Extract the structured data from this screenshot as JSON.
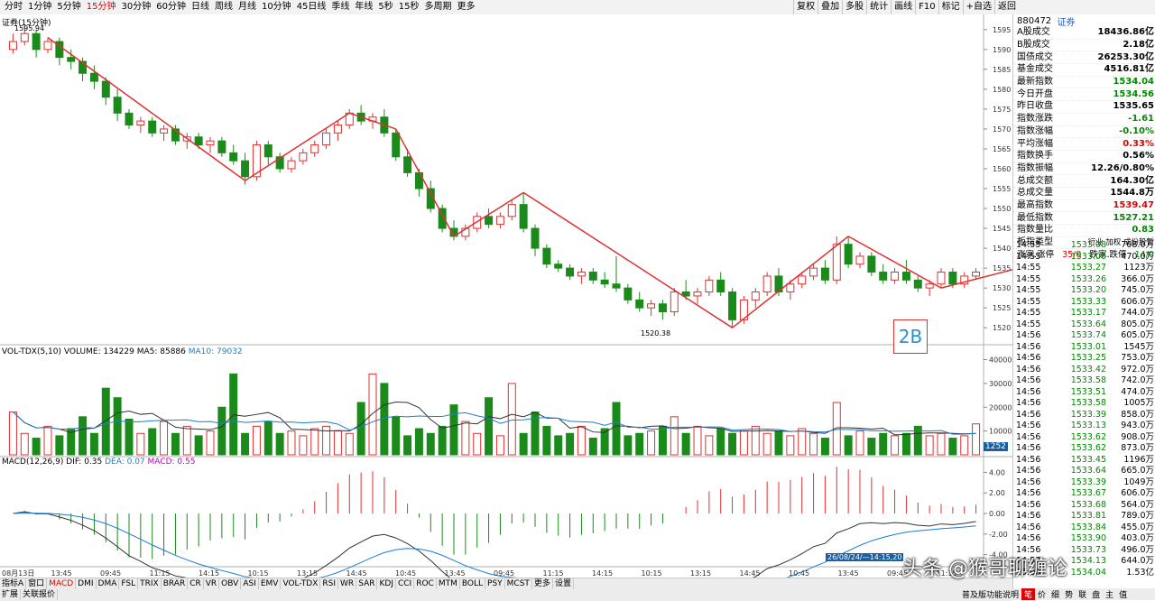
{
  "period_tabs": [
    "分时",
    "1分钟",
    "5分钟",
    "15分钟",
    "30分钟",
    "60分钟",
    "日线",
    "周线",
    "月线",
    "10分钟",
    "45日线",
    "季线",
    "年线",
    "5秒",
    "15秒",
    "多周期",
    "更多"
  ],
  "active_period": "15分钟",
  "right_buttons": [
    "复权",
    "叠加",
    "多股",
    "统计",
    "画线",
    "F10",
    "标记",
    "+自选",
    "返回"
  ],
  "chart": {
    "title": "证券(15分钟)",
    "high_label": "1595.94",
    "low_label": "1520.38",
    "y_ticks": [
      1595,
      1590,
      1585,
      1580,
      1575,
      1570,
      1565,
      1560,
      1555,
      1550,
      1545,
      1540,
      1535,
      1530,
      1525,
      1520
    ],
    "annotation": "2B"
  },
  "volume": {
    "label": "VOL-TDX(5,10)",
    "volume_text": "VOLUME: 134229",
    "ma5_text": "MA5: 85886",
    "ma10_text": "MA10: 79032",
    "y_ticks": [
      "40000",
      "30000",
      "20000",
      "10000"
    ],
    "current": "1252"
  },
  "macd": {
    "label": "MACD(12,26,9)",
    "dif_text": "DIF: 0.35",
    "dea_text": "DEA: 0.07",
    "macd_text": "MACD: 0.55",
    "y_ticks": [
      "4.00",
      "2.00",
      "0.00",
      "-2.00",
      "-4.00"
    ]
  },
  "time_axis": [
    "08月13日",
    "13:45",
    "09:45",
    "11:15",
    "14:15",
    "10:15",
    "13:15",
    "14:45",
    "10:45",
    "13:45",
    "09:45",
    "11:15",
    "14:15",
    "10:15",
    "13:15",
    "14:45",
    "10:45",
    "13:45",
    "09:45",
    "11:15"
  ],
  "cursor_time": "26/08/24/—14:15,20",
  "indicator_tabs": [
    "指标A",
    "窗口",
    "MACD",
    "DMI",
    "DMA",
    "FSL",
    "TRIX",
    "BRAR",
    "CR",
    "VR",
    "OBV",
    "ASI",
    "EMV",
    "VOL-TDX",
    "RSI",
    "WR",
    "SAR",
    "KDJ",
    "CCI",
    "ROC",
    "MTM",
    "BOLL",
    "PSY",
    "MCST",
    "更多",
    "设置"
  ],
  "active_indicator": "MACD",
  "bottom_tabs": [
    "扩展",
    "关联报价"
  ],
  "indicator_b": "指标B",
  "panel": {
    "code": "880472",
    "name": "证券",
    "stats": [
      {
        "k": "A股成交",
        "v": "18436.86亿",
        "c": "#000"
      },
      {
        "k": "B股成交",
        "v": "2.18亿",
        "c": "#000"
      },
      {
        "k": "国债成交",
        "v": "26253.30亿",
        "c": "#000"
      },
      {
        "k": "基金成交",
        "v": "4516.81亿",
        "c": "#000"
      },
      {
        "k": "最新指数",
        "v": "1534.04",
        "c": "#080"
      },
      {
        "k": "今日开盘",
        "v": "1534.56",
        "c": "#080"
      },
      {
        "k": "昨日收盘",
        "v": "1535.65",
        "c": "#000"
      },
      {
        "k": "指数涨跌",
        "v": "-1.61",
        "c": "#080"
      },
      {
        "k": "指数涨幅",
        "v": "-0.10%",
        "c": "#080"
      },
      {
        "k": "平均涨幅",
        "v": "0.33%",
        "c": "#e00000"
      },
      {
        "k": "指数换手",
        "v": "0.56%",
        "c": "#000"
      },
      {
        "k": "指数振幅",
        "v": "12.26/0.80%",
        "c": "#000"
      },
      {
        "k": "总成交额",
        "v": "164.30亿",
        "c": "#000"
      },
      {
        "k": "总成交量",
        "v": "1544.8万",
        "c": "#000"
      },
      {
        "k": "最高指数",
        "v": "1539.47",
        "c": "#e00000"
      },
      {
        "k": "最低指数",
        "v": "1527.21",
        "c": "#080"
      },
      {
        "k": "指数量比",
        "v": "0.83",
        "c": "#080"
      },
      {
        "k": "板指类型",
        "v": "行业 加权 成份股暂",
        "c": "#000"
      }
    ],
    "updown_label": "涨家.涨停",
    "updown_value": "35/0",
    "down_label": "跌家.跌停",
    "down_value": "14/0",
    "trades": [
      [
        "14:55",
        "1533.08",
        "708.0万"
      ],
      [
        "14:55",
        "1533.00",
        "470.0万"
      ],
      [
        "14:55",
        "1533.27",
        "1123万"
      ],
      [
        "14:55",
        "1533.26",
        "366.0万"
      ],
      [
        "14:55",
        "1533.20",
        "745.0万"
      ],
      [
        "14:55",
        "1533.33",
        "606.0万"
      ],
      [
        "14:55",
        "1533.17",
        "744.0万"
      ],
      [
        "14:55",
        "1533.64",
        "805.0万"
      ],
      [
        "14:56",
        "1533.74",
        "605.0万"
      ],
      [
        "14:56",
        "1533.01",
        "1545万"
      ],
      [
        "14:56",
        "1533.25",
        "753.0万"
      ],
      [
        "14:56",
        "1533.42",
        "972.0万"
      ],
      [
        "14:56",
        "1533.58",
        "742.0万"
      ],
      [
        "14:56",
        "1533.51",
        "474.0万"
      ],
      [
        "14:56",
        "1533.58",
        "1005万"
      ],
      [
        "14:56",
        "1533.39",
        "858.0万"
      ],
      [
        "14:56",
        "1533.13",
        "943.0万"
      ],
      [
        "14:56",
        "1533.62",
        "908.0万"
      ],
      [
        "14:56",
        "1533.62",
        "873.0万"
      ],
      [
        "14:56",
        "1533.45",
        "1196万"
      ],
      [
        "14:56",
        "1533.64",
        "665.0万"
      ],
      [
        "14:56",
        "1533.39",
        "1049万"
      ],
      [
        "14:56",
        "1533.67",
        "606.0万"
      ],
      [
        "14:56",
        "1533.68",
        "564.0万"
      ],
      [
        "14:56",
        "1533.81",
        "789.0万"
      ],
      [
        "14:56",
        "1533.84",
        "455.0万"
      ],
      [
        "14:56",
        "1533.90",
        "403.0万"
      ],
      [
        "14:56",
        "1533.73",
        "496.0万"
      ],
      [
        "14:57",
        "1534.13",
        "644.0万"
      ],
      [
        "15:00",
        "1534.04",
        "1.53亿"
      ]
    ],
    "bottom_status": "普及版功能说明",
    "bottom_icons": [
      "笔",
      "价",
      "细",
      "势",
      "联",
      "盘",
      "主",
      "值"
    ]
  },
  "watermark": "头条 @猴哥聊缠论",
  "series": [
    [
      1590,
      1594,
      1589,
      1592
    ],
    [
      1592,
      1596,
      1591,
      1594
    ],
    [
      1594,
      1595,
      1588,
      1590
    ],
    [
      1590,
      1593,
      1589,
      1592
    ],
    [
      1592,
      1593,
      1586,
      1588
    ],
    [
      1588,
      1590,
      1585,
      1587
    ],
    [
      1587,
      1588,
      1582,
      1584
    ],
    [
      1584,
      1586,
      1580,
      1582
    ],
    [
      1582,
      1583,
      1576,
      1578
    ],
    [
      1578,
      1580,
      1572,
      1574
    ],
    [
      1574,
      1575,
      1570,
      1571
    ],
    [
      1571,
      1573,
      1569,
      1572
    ],
    [
      1572,
      1573,
      1568,
      1569
    ],
    [
      1569,
      1571,
      1567,
      1570
    ],
    [
      1570,
      1571,
      1566,
      1567
    ],
    [
      1567,
      1569,
      1565,
      1568
    ],
    [
      1568,
      1569,
      1565,
      1566
    ],
    [
      1566,
      1568,
      1564,
      1567
    ],
    [
      1567,
      1568,
      1563,
      1564
    ],
    [
      1564,
      1566,
      1561,
      1562
    ],
    [
      1562,
      1564,
      1556,
      1558
    ],
    [
      1558,
      1567,
      1557,
      1566
    ],
    [
      1566,
      1567,
      1561,
      1563
    ],
    [
      1563,
      1564,
      1559,
      1560
    ],
    [
      1560,
      1563,
      1559,
      1562
    ],
    [
      1562,
      1565,
      1561,
      1564
    ],
    [
      1564,
      1567,
      1563,
      1566
    ],
    [
      1566,
      1570,
      1565,
      1569
    ],
    [
      1569,
      1572,
      1567,
      1571
    ],
    [
      1571,
      1575,
      1570,
      1574
    ],
    [
      1574,
      1576,
      1571,
      1572
    ],
    [
      1572,
      1574,
      1570,
      1573
    ],
    [
      1573,
      1575,
      1568,
      1569
    ],
    [
      1569,
      1570,
      1562,
      1563
    ],
    [
      1563,
      1565,
      1558,
      1559
    ],
    [
      1559,
      1560,
      1553,
      1555
    ],
    [
      1555,
      1557,
      1549,
      1550
    ],
    [
      1550,
      1551,
      1544,
      1545
    ],
    [
      1545,
      1547,
      1542,
      1543
    ],
    [
      1543,
      1546,
      1542,
      1545
    ],
    [
      1545,
      1549,
      1544,
      1548
    ],
    [
      1548,
      1550,
      1545,
      1546
    ],
    [
      1546,
      1549,
      1545,
      1548
    ],
    [
      1548,
      1552,
      1547,
      1551
    ],
    [
      1551,
      1554,
      1544,
      1545
    ],
    [
      1545,
      1546,
      1538,
      1540
    ],
    [
      1540,
      1541,
      1535,
      1536
    ],
    [
      1536,
      1537,
      1534,
      1535
    ],
    [
      1535,
      1536,
      1532,
      1533
    ],
    [
      1533,
      1535,
      1531,
      1534
    ],
    [
      1534,
      1535,
      1531,
      1532
    ],
    [
      1532,
      1534,
      1530,
      1531
    ],
    [
      1531,
      1538,
      1529,
      1530
    ],
    [
      1530,
      1531,
      1526,
      1527
    ],
    [
      1527,
      1529,
      1524,
      1525
    ],
    [
      1525,
      1527,
      1523,
      1526
    ],
    [
      1526,
      1527,
      1522,
      1524
    ],
    [
      1524,
      1530,
      1523,
      1529
    ],
    [
      1529,
      1532,
      1527,
      1528
    ],
    [
      1528,
      1530,
      1526,
      1529
    ],
    [
      1529,
      1533,
      1528,
      1532
    ],
    [
      1532,
      1534,
      1528,
      1529
    ],
    [
      1529,
      1530,
      1520,
      1522
    ],
    [
      1522,
      1528,
      1521,
      1527
    ],
    [
      1527,
      1530,
      1525,
      1529
    ],
    [
      1529,
      1534,
      1528,
      1533
    ],
    [
      1533,
      1535,
      1528,
      1529
    ],
    [
      1529,
      1532,
      1527,
      1531
    ],
    [
      1531,
      1534,
      1530,
      1533
    ],
    [
      1533,
      1536,
      1532,
      1535
    ],
    [
      1535,
      1537,
      1531,
      1532
    ],
    [
      1532,
      1543,
      1531,
      1541
    ],
    [
      1541,
      1543,
      1535,
      1536
    ],
    [
      1536,
      1539,
      1535,
      1538
    ],
    [
      1538,
      1539,
      1533,
      1534
    ],
    [
      1534,
      1536,
      1531,
      1532
    ],
    [
      1532,
      1535,
      1531,
      1534
    ],
    [
      1534,
      1537,
      1531,
      1532
    ],
    [
      1532,
      1533,
      1529,
      1530
    ],
    [
      1530,
      1532,
      1528,
      1531
    ],
    [
      1531,
      1535,
      1530,
      1534
    ],
    [
      1534,
      1535,
      1530,
      1531
    ],
    [
      1531,
      1534,
      1530,
      1533
    ],
    [
      1533,
      1535,
      1532,
      1534
    ]
  ],
  "volumes": [
    18000,
    9000,
    7000,
    12000,
    8000,
    11000,
    16000,
    9000,
    28000,
    24000,
    15000,
    9000,
    11000,
    14000,
    9000,
    12000,
    8000,
    10000,
    20000,
    34000,
    9000,
    12000,
    14000,
    9000,
    10000,
    8000,
    11000,
    12000,
    10000,
    9000,
    22000,
    34000,
    30000,
    16000,
    8000,
    11000,
    9000,
    12000,
    21000,
    14000,
    9000,
    24000,
    8000,
    30000,
    9000,
    18000,
    12000,
    8000,
    9000,
    12000,
    7000,
    11000,
    22000,
    8000,
    9000,
    10000,
    12000,
    16000,
    9000,
    12000,
    8000,
    11000,
    9000,
    10000,
    12000,
    9000,
    10000,
    8000,
    11000,
    9000,
    7000,
    22000,
    8000,
    10000,
    7000,
    9000,
    8000,
    9000,
    12000,
    8000,
    9000,
    7000,
    8000,
    13000
  ]
}
